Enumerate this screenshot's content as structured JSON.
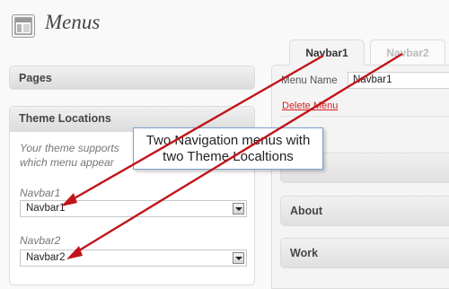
{
  "header": {
    "title": "Menus",
    "icon": "menus-screen-icon"
  },
  "sidebar": {
    "pages_heading": "Pages",
    "theme_locations_heading": "Theme Locations",
    "description_line1": "Your theme supports",
    "description_line2": "which menu appear",
    "locations": [
      {
        "label": "Navbar1",
        "selected": "Navbar1"
      },
      {
        "label": "Navbar2",
        "selected": "Navbar2"
      }
    ]
  },
  "main": {
    "tabs": [
      {
        "label": "Navbar1",
        "active": true
      },
      {
        "label": "Navbar2",
        "active": false
      }
    ],
    "menu_name_label": "Menu Name",
    "menu_name_value": "Navbar1",
    "delete_link": "Delete Menu",
    "items": [
      "",
      "About",
      "Work"
    ]
  },
  "annotation": {
    "line1": "Two Navigation menus with",
    "line2": "two Theme Localtions",
    "arrow_color": "#c0141a"
  }
}
